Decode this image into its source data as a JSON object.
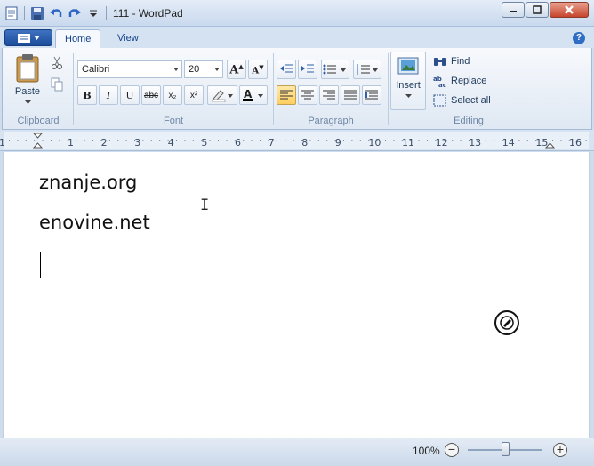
{
  "window": {
    "title": "111 - WordPad"
  },
  "quick_access": {
    "icons": [
      "wordpad-icon",
      "save-icon",
      "undo-icon",
      "redo-icon",
      "customize-icon"
    ]
  },
  "tabs": [
    {
      "label": "Home",
      "active": true
    },
    {
      "label": "View",
      "active": false
    }
  ],
  "clipboard": {
    "paste_label": "Paste",
    "group_label": "Clipboard"
  },
  "font": {
    "family": "Calibri",
    "size": "20",
    "group_label": "Font",
    "bold": "B",
    "italic": "I",
    "underline": "U",
    "strike": "abc",
    "subscript": "x₂",
    "superscript": "x²"
  },
  "paragraph": {
    "group_label": "Paragraph",
    "alignment": "left"
  },
  "insert": {
    "label": "Insert"
  },
  "editing": {
    "group_label": "Editing",
    "find_label": "Find",
    "replace_label": "Replace",
    "select_all_label": "Select all"
  },
  "ruler": {
    "ticks": [
      "1",
      "1",
      "2",
      "3",
      "4",
      "5",
      "6",
      "7",
      "8",
      "9",
      "10",
      "11",
      "12",
      "13",
      "14",
      "15",
      "16"
    ]
  },
  "document": {
    "lines": [
      "znanje.org",
      "enovine.net"
    ]
  },
  "status": {
    "zoom": "100%",
    "zoom_level": 0.5
  },
  "colors": {
    "accent": "#2f6cc3",
    "ribbon_bg": "#dfe8f3",
    "title_bg": "#c9d9ee"
  }
}
